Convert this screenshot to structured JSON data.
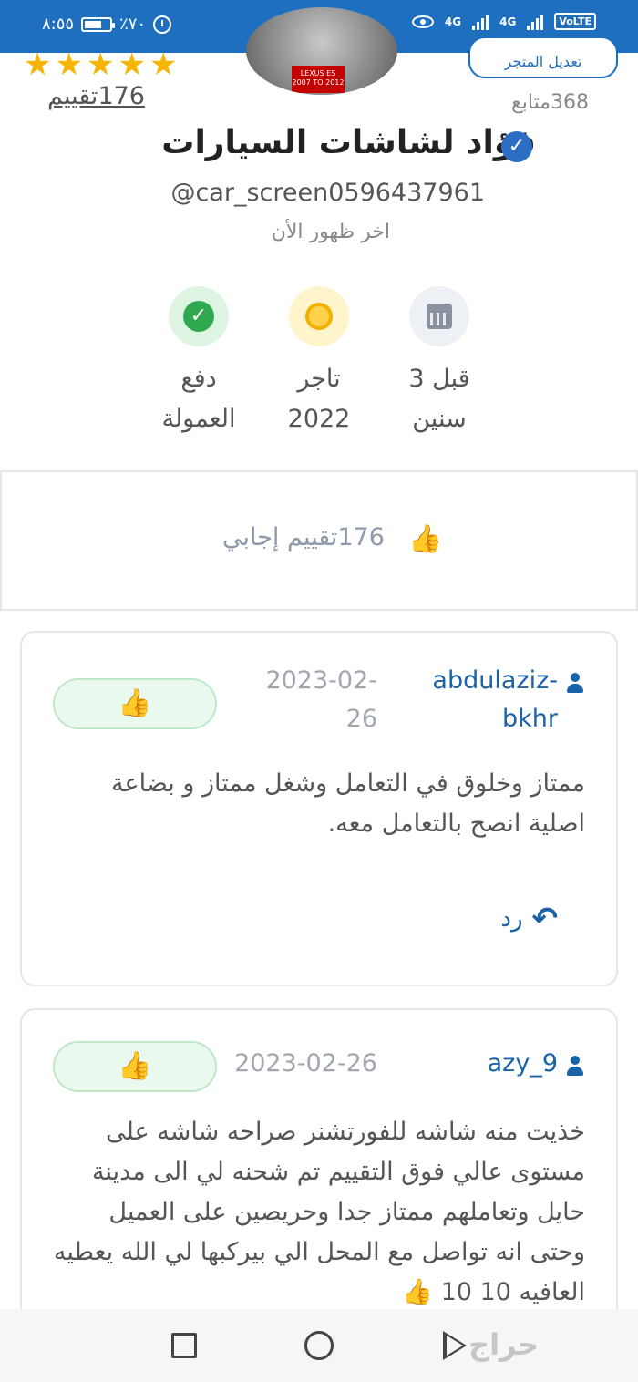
{
  "status_bar": {
    "time": "٨:٥٥",
    "battery_text": "٪٧٠",
    "battery_level": 0.7,
    "network_1": "4G",
    "network_2": "4G",
    "volte": "VoLTE"
  },
  "profile": {
    "rating_stars": 5,
    "ratings_link": "176تقييم",
    "edit_store_button": "تعديل المتجر",
    "followers": "368متابع",
    "store_name": "فؤاد لشاشات السيارات",
    "handle": "@car_screen0596437961",
    "last_seen": "اخر ظهور الأن",
    "avatar_tag": "LEXUS ES 2007 TO 2012",
    "badges": [
      {
        "icon": "calendar-icon",
        "label_line1": "قبل 3",
        "label_line2": "سنين"
      },
      {
        "icon": "medal-icon",
        "label_line1": "تاجر",
        "label_line2": "2022"
      },
      {
        "icon": "verified-seal-icon",
        "label_line1": "دفع",
        "label_line2": "العمولة"
      }
    ]
  },
  "positive_summary": {
    "text": "176تقييم إجابي"
  },
  "reviews": [
    {
      "user_line1": "abdulaziz-",
      "user_line2": "bkhr",
      "date_line1": "2023-02-",
      "date_line2": "26",
      "body": "ممتاز وخلوق في التعامل وشغل ممتاز و بضاعة اصلية انصح بالتعامل معه.",
      "reply_label": "رد"
    },
    {
      "user_line1": "azy_9",
      "date_line1": "2023-02-26",
      "body": "خذيت منه شاشه للفورتشنر صراحه شاشه على مستوى عالي فوق التقييم تم شحنه لي الى مدينة حايل وتعاملهم ممتاز جدا وحريصين على العميل وحتى انه تواصل مع المحل الي بيركبها لي الله يعطيه العافيه 10 10"
    }
  ],
  "watermark": "حراج"
}
